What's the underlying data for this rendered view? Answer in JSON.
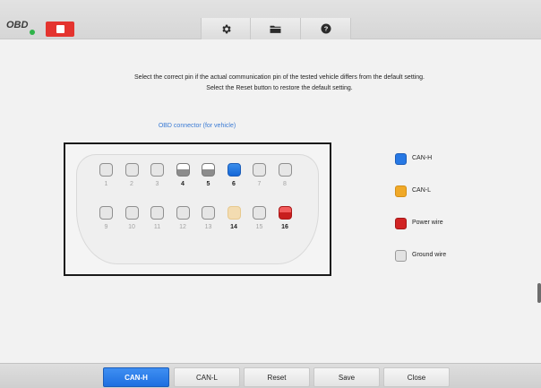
{
  "topbar": {
    "obd_label": "OBD",
    "status_color": "#2fb34a",
    "stop_color": "#e4342f",
    "tools": [
      {
        "icon": "gear-icon"
      },
      {
        "icon": "folder-icon"
      },
      {
        "icon": "help-icon"
      }
    ]
  },
  "instructions": {
    "line1": "Select the correct pin if the actual communication pin of the tested vehicle differs from the default setting.",
    "line2": "Select the Reset button to restore the default setting."
  },
  "connector": {
    "title": "OBD connector (for vehicle)",
    "top_row": [
      {
        "num": "1",
        "state": "empty"
      },
      {
        "num": "2",
        "state": "empty"
      },
      {
        "num": "3",
        "state": "empty"
      },
      {
        "num": "4",
        "state": "gray"
      },
      {
        "num": "5",
        "state": "gray"
      },
      {
        "num": "6",
        "state": "blue"
      },
      {
        "num": "7",
        "state": "empty"
      },
      {
        "num": "8",
        "state": "empty"
      }
    ],
    "bottom_row": [
      {
        "num": "9",
        "state": "empty"
      },
      {
        "num": "10",
        "state": "empty"
      },
      {
        "num": "11",
        "state": "empty"
      },
      {
        "num": "12",
        "state": "empty"
      },
      {
        "num": "13",
        "state": "empty"
      },
      {
        "num": "14",
        "state": "orange-light"
      },
      {
        "num": "15",
        "state": "empty"
      },
      {
        "num": "16",
        "state": "red"
      }
    ]
  },
  "legend": [
    {
      "label": "CAN-H",
      "color": "#1e6fe0"
    },
    {
      "label": "CAN-L",
      "color": "#f0a928"
    },
    {
      "label": "Power wire",
      "color": "#d12323"
    },
    {
      "label": "Ground wire",
      "color": "#dedede"
    }
  ],
  "bottombar": {
    "buttons": [
      {
        "label": "CAN-H",
        "active": true
      },
      {
        "label": "CAN-L",
        "active": false
      },
      {
        "label": "Reset",
        "active": false
      },
      {
        "label": "Save",
        "active": false
      },
      {
        "label": "Close",
        "active": false
      }
    ]
  }
}
